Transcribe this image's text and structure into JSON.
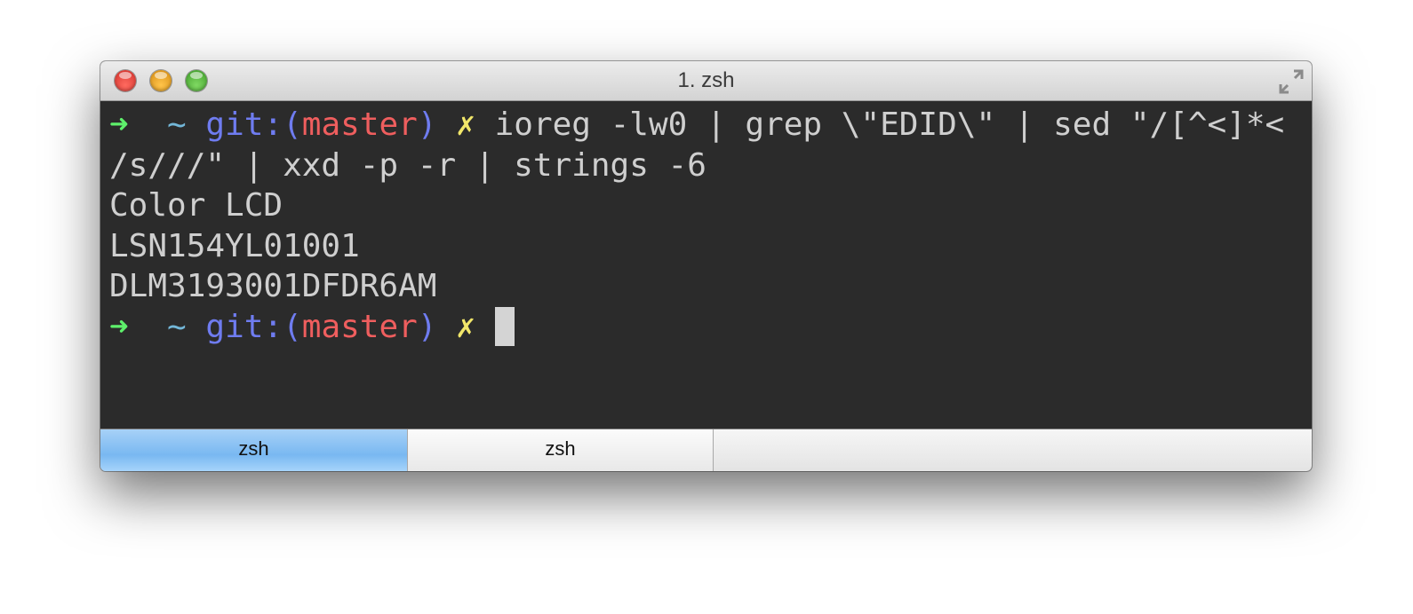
{
  "window": {
    "title": "1. zsh"
  },
  "terminal": {
    "prompt": {
      "arrow": "➜",
      "dir": "~",
      "git_prefix": "git:(",
      "branch": "master",
      "git_suffix": ")",
      "dirty_marker": "✗"
    },
    "command_line_1": "ioreg -lw0 | grep \\\"EDID\\\" | sed \"/[^<]*<",
    "command_line_2": "/s///\" | xxd -p -r | strings -6",
    "output": [
      "Color LCD",
      "LSN154YL01001",
      "DLM3193001DFDR6AM"
    ]
  },
  "tabs": [
    {
      "label": "zsh",
      "active": true
    },
    {
      "label": "zsh",
      "active": false
    }
  ],
  "colors": {
    "background": "#2b2b2b",
    "text": "#cfcfcf",
    "prompt_arrow": "#5ef06b",
    "git": "#6f7cf0",
    "branch": "#ef5e5e",
    "dirty": "#f2e76a",
    "active_tab": "#79b8f1"
  },
  "icons": {
    "close": "close-button",
    "minimize": "minimize-button",
    "zoom": "zoom-button",
    "fullscreen": "fullscreen-icon"
  }
}
